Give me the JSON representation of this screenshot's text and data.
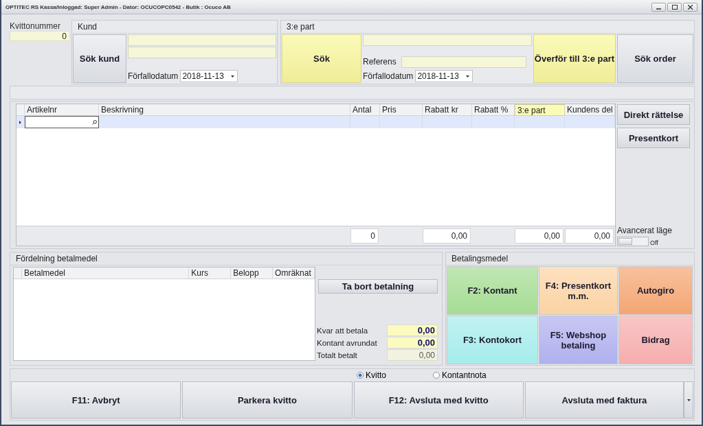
{
  "window": {
    "title": "OPTITEC RS Kassa/Inloggad: Super Admin - Dator: OCUCOPC0542 -  Butik : Ocuco AB"
  },
  "receipt": {
    "label": "Kvittonummer",
    "value": "0"
  },
  "customer": {
    "title": "Kund",
    "search_button": "Sök kund",
    "due_label": "Förfallodatum",
    "due_date": "2018-11-13"
  },
  "third_party": {
    "title": "3:e part",
    "search_button": "Sök",
    "reference_label": "Referens",
    "due_label": "Förfallodatum",
    "due_date": "2018-11-13",
    "transfer_button": "Överför till 3:e part",
    "order_button": "Sök order"
  },
  "articles": {
    "columns": [
      {
        "label": "Artikelnr",
        "selected": false
      },
      {
        "label": "Beskrivning",
        "selected": false
      },
      {
        "label": "Antal",
        "selected": false,
        "total": "0"
      },
      {
        "label": "Pris",
        "selected": false
      },
      {
        "label": "Rabatt kr",
        "selected": false,
        "total": "0,00"
      },
      {
        "label": "Rabatt %",
        "selected": false
      },
      {
        "label": "3:e part",
        "selected": true,
        "total": "0,00"
      },
      {
        "label": "Kundens del",
        "selected": false,
        "total": "0,00"
      }
    ],
    "side_buttons": [
      "Direkt rättelse",
      "Presentkort"
    ],
    "advanced": {
      "label": "Avancerat läge",
      "on": false,
      "state_text": "Off"
    }
  },
  "payments": {
    "title": "Fördelning betalmedel",
    "columns": [
      "Betalmedel",
      "Kurs",
      "Belopp",
      "Omräknat"
    ],
    "remove_button": "Ta bort betalning",
    "summary": [
      {
        "label": "Kvar att betala",
        "value": "0,00",
        "highlighted": true
      },
      {
        "label": "Kontant avrundat",
        "value": "0,00",
        "highlighted": true
      },
      {
        "label": "Totalt betalt",
        "value": "0,00",
        "highlighted": false
      }
    ]
  },
  "methods": {
    "title": "Betalingsmedel",
    "items": [
      {
        "label": "F2: Kontant",
        "color": "#a6dc94"
      },
      {
        "label": "F4: Presentkort m.m.",
        "color": "#fbd3a4"
      },
      {
        "label": "Autogiro",
        "color": "#f4a673"
      },
      {
        "label": "F3: Kontokort",
        "color": "#a6ecec"
      },
      {
        "label": "F5: Webshop betaling",
        "color": "#b0b0ee"
      },
      {
        "label": "Bidrag",
        "color": "#f6adad"
      }
    ]
  },
  "receipt_type": [
    {
      "label": "Kvitto",
      "selected": true
    },
    {
      "label": "Kontantnota",
      "selected": false
    }
  ],
  "actions": [
    {
      "label": "F11: Avbryt",
      "kind": "plain"
    },
    {
      "label": "Parkera kvitto",
      "kind": "plain"
    },
    {
      "label": "F12: Avsluta med kvitto",
      "kind": "plain"
    },
    {
      "label": "Avsluta med faktura",
      "kind": "split"
    }
  ]
}
